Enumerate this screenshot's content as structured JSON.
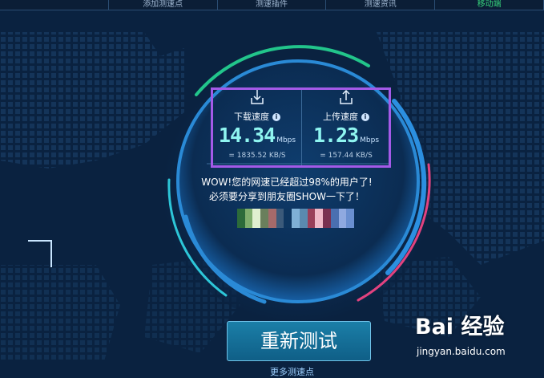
{
  "nav": {
    "tabs": [
      {
        "label": ""
      },
      {
        "label": "添加测速点"
      },
      {
        "label": "测速插件"
      },
      {
        "label": "测速资讯"
      },
      {
        "label": "移动端"
      }
    ]
  },
  "download": {
    "title": "下载速度",
    "value": "14.34",
    "unit": "Mbps",
    "kbs": "= 1835.52 KB/S"
  },
  "upload": {
    "title": "上传速度",
    "value": "1.23",
    "unit": "Mbps",
    "kbs": "= 157.44 KB/S"
  },
  "message": {
    "line1": "WOW!您的网速已经超过98%的用户了!",
    "line2": "必须要分享到朋友圈SHOW一下了！"
  },
  "buttons": {
    "retest": "重新测试",
    "more": "更多测速点"
  },
  "watermark": {
    "logo": "Bai 经验",
    "url": "jingyan.baidu.com"
  },
  "colors": {
    "background": "#0a2240",
    "highlight_box": "#a45ae8",
    "speed_digits": "#8ff5f0",
    "active_tab": "#36d07a"
  }
}
